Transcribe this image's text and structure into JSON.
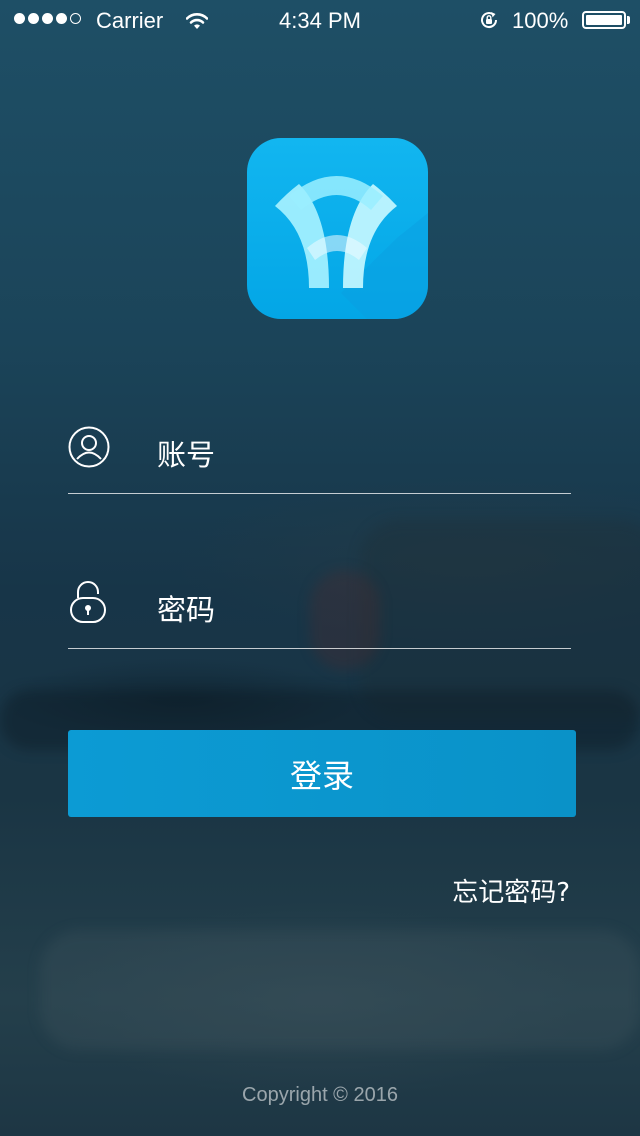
{
  "status_bar": {
    "carrier": "Carrier",
    "time": "4:34 PM",
    "battery_percent": "100%",
    "signal_bars_filled": 4,
    "signal_bars_total": 5,
    "battery_level": 1.0
  },
  "logo": {
    "icon": "app-logo-icon",
    "background_color": "#03a6e6"
  },
  "login_form": {
    "account_placeholder": "账号",
    "account_icon": "user-icon",
    "password_placeholder": "密码",
    "password_icon": "unlock-icon",
    "login_button_label": "登录",
    "forgot_password_label": "忘记密码?"
  },
  "footer": {
    "copyright": "Copyright © 2016"
  },
  "colors": {
    "accent": "#0a95cc",
    "background": "#1d3f52"
  }
}
